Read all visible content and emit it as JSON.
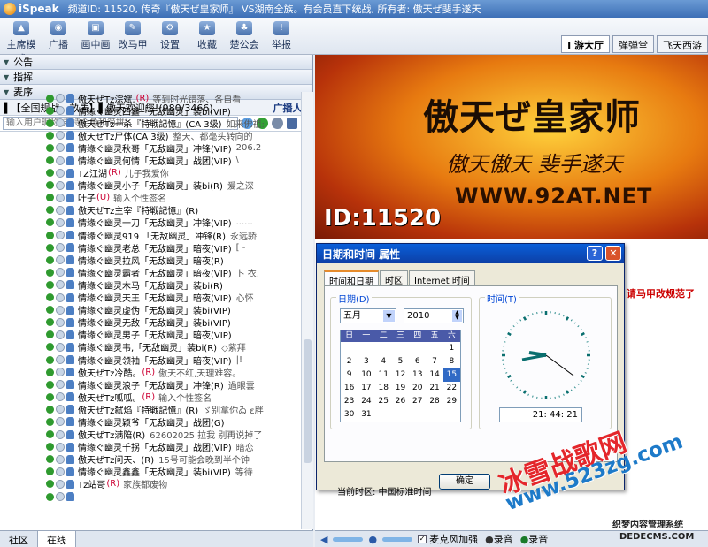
{
  "titlebar": {
    "app_name": "iSpeak",
    "info": "频道ID: 11520, 传奇『傲天ぜ皇家师』 VS湖南全族。有会员直下统战, 所有者: 傲天ぜ斐手遂天"
  },
  "toolbar": {
    "items": [
      "主席模式",
      "广播",
      "画中画",
      "改马甲",
      "设置",
      "收藏",
      "楚公会",
      "举报"
    ]
  },
  "room_tabs": [
    "I 游大厅",
    "弹弹堂",
    "飞天西游"
  ],
  "sections": [
    "公告",
    "指挥",
    "麦序"
  ],
  "channel": {
    "name": "▌【全国规战、畝盾】▌傲天欢迎您!(980/3466)",
    "broadcast": "广播人:("
  },
  "search": {
    "placeholder": "输入用户昵称(支持全角和简拼)"
  },
  "users": [
    {
      "name": "傲天ぜTz淙斌,",
      "tag": "(R)",
      "msg": "等到时光错落、各自看"
    },
    {
      "name": "情缘ぐ幽灵四鑫「无敌幽灵」装bi(VIP)",
      "tag": "",
      "msg": ""
    },
    {
      "name": "傲天ぜTz一杀『特戦記憶』(CA 3级)",
      "tag": "",
      "msg": "如来佛祖:"
    },
    {
      "name": "傲天ぜTz尸体(CA 3级)",
      "tag": "",
      "msg": "整天、都毫头转向的"
    },
    {
      "name": "情缘ぐ幽灵秋哥「无敌幽灵」冲锋(VIP)",
      "tag": "",
      "msg": "206.2"
    },
    {
      "name": "情缘ぐ幽灵何情「无敌幽灵」战团(VIP)",
      "tag": "",
      "msg": "\\"
    },
    {
      "name": "TZ江湖",
      "tag": "(R)",
      "msg": "儿子我爱你"
    },
    {
      "name": "情缘ぐ幽灵小子「无敌幽灵」装bi(R)",
      "tag": "",
      "msg": "爱之深"
    },
    {
      "name": "叶子",
      "tag": "(U)",
      "msg": "输入个性签名"
    },
    {
      "name": "傲天ぜTz主宰『特戦記憶』(R)",
      "tag": "",
      "msg": ""
    },
    {
      "name": "情缘ぐ幽灵一刀「无敌幽灵」冲锋(VIP)",
      "tag": "",
      "msg": "......"
    },
    {
      "name": "情缘ぐ幽灵919 「无敌幽灵」冲锋(R)",
      "tag": "",
      "msg": "永远骄"
    },
    {
      "name": "情缘ぐ幽灵老总「无敌幽灵」暗夜(VIP)",
      "tag": "",
      "msg": "[ -"
    },
    {
      "name": "情缘ぐ幽灵拉风「无敌幽灵」暗夜(R)",
      "tag": "",
      "msg": ""
    },
    {
      "name": "情缘ぐ幽灵霸者「无敌幽灵」暗夜(VIP)",
      "tag": "",
      "msg": "卜 衣,"
    },
    {
      "name": "情缘ぐ幽灵木马「无敌幽灵」装bi(R)",
      "tag": "",
      "msg": ""
    },
    {
      "name": "情缘ぐ幽灵天王「无敌幽灵」暗夜(VIP)",
      "tag": "",
      "msg": "心怀"
    },
    {
      "name": "情缘ぐ幽灵虚伪「无敌幽灵」装bi(VIP)",
      "tag": "",
      "msg": ""
    },
    {
      "name": "情缘ぐ幽灵无敌「无敌幽灵」装bi(VIP)",
      "tag": "",
      "msg": ""
    },
    {
      "name": "情缘ぐ幽灵男子「无敌幽灵」暗夜(VIP)",
      "tag": "",
      "msg": ""
    },
    {
      "name": "情缘ぐ幽灵韦,「无敌幽灵」装bi(R)",
      "tag": "",
      "msg": "◇紫拜"
    },
    {
      "name": "情缘ぐ幽灵领袖「无敌幽灵」暗夜(VIP)",
      "tag": "",
      "msg": "|!"
    },
    {
      "name": "傲天ぜTz冷酷。",
      "tag": "(R)",
      "msg": "傲天不红,天理难容。"
    },
    {
      "name": "情缘ぐ幽灵浪子「无敌幽灵」冲锋(R)",
      "tag": "",
      "msg": "過眼雲"
    },
    {
      "name": "傲天ぜTz呱呱。",
      "tag": "(R)",
      "msg": "输入个性签名"
    },
    {
      "name": "傲天ぜTz弑焰『特戦記憶』(R)",
      "tag": "",
      "msg": "ゞ别拿你ゐ ε胖"
    },
    {
      "name": "情缘ぐ幽灵颖爷「无敌幽灵」战团(G)",
      "tag": "",
      "msg": ""
    },
    {
      "name": "傲天ぜTz满陪(R)",
      "tag": "",
      "msg": "62602025  拉我 别再说掉了"
    },
    {
      "name": "情缘ぐ幽灵千拐「无敌幽灵」战团(VIP)",
      "tag": "",
      "msg": "暗恋"
    },
    {
      "name": "傲天ぜTz问天、(R)",
      "tag": "",
      "msg": "15号可能会晚到半个钟"
    },
    {
      "name": "情缘ぐ幽灵鑫鑫「无敌幽灵」装bi(VIP)",
      "tag": "",
      "msg": "等待"
    },
    {
      "name": "Tz站哥",
      "tag": "(R)",
      "msg": "家族都废物"
    },
    {
      "name": "",
      "tag": "",
      "msg": ""
    }
  ],
  "bottom_tabs": [
    "社区",
    "在线"
  ],
  "banner": {
    "title": "傲天ぜ皇家师",
    "slogan": "傲天傲天 斐手遂天",
    "url": "WWW.92AT.NET",
    "id_text": "ID:11520"
  },
  "chat": {
    "red_msg": "请马甲改规范了",
    "bullet": "◆"
  },
  "rbottom": {
    "mic_label": "麦克风加强",
    "record_label": "录音",
    "rec2": "录音"
  },
  "dialog": {
    "title": "日期和时间 属性",
    "tabs": [
      "时间和日期",
      "时区",
      "Internet 时间"
    ],
    "date_group": "日期(D)",
    "time_group": "时间(T)",
    "month": "五月",
    "year": "2010",
    "weekdays": [
      "日",
      "一",
      "二",
      "三",
      "四",
      "五",
      "六"
    ],
    "weeks": [
      [
        "",
        "",
        "",
        "",
        "",
        "",
        "1"
      ],
      [
        "2",
        "3",
        "4",
        "5",
        "6",
        "7",
        "8"
      ],
      [
        "9",
        "10",
        "11",
        "12",
        "13",
        "14",
        "15"
      ],
      [
        "16",
        "17",
        "18",
        "19",
        "20",
        "21",
        "22"
      ],
      [
        "23",
        "24",
        "25",
        "26",
        "27",
        "28",
        "29"
      ],
      [
        "30",
        "31",
        "",
        "",
        "",
        "",
        ""
      ]
    ],
    "selected_day": "15",
    "time": "21: 44: 21",
    "timezone": "当前时区: 中国标准时间",
    "ok": "确定",
    "help_icon": "?",
    "close_icon": "✕"
  },
  "watermark": {
    "line1": "冰雪战歌网",
    "line2": "www.523zg.com",
    "line3": "织梦内容管理系统",
    "line4": "DEDECMS.COM"
  }
}
